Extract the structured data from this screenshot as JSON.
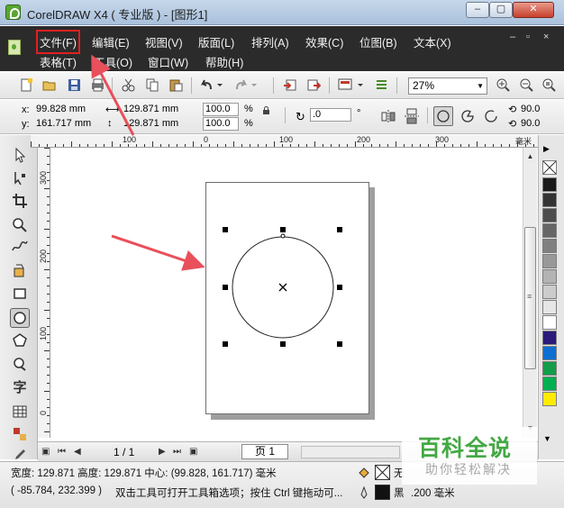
{
  "window": {
    "title": "CorelDRAW X4 ( 专业版 ) - [图形1]",
    "min_label": "–",
    "max_label": "▢",
    "close_label": "✕"
  },
  "menu": {
    "row1": [
      "文件(F)",
      "编辑(E)",
      "视图(V)",
      "版面(L)",
      "排列(A)",
      "效果(C)",
      "位图(B)",
      "文本(X)"
    ],
    "row2": [
      "表格(T)",
      "工具(O)",
      "窗口(W)",
      "帮助(H)"
    ],
    "mdi_buttons": [
      "–",
      "▫",
      "×"
    ]
  },
  "standard_toolbar": {
    "zoom_value": "27%",
    "icons": [
      "new-icon",
      "open-icon",
      "save-icon",
      "print-icon",
      "cut-icon",
      "copy-icon",
      "paste-icon",
      "undo-icon",
      "redo-icon",
      "import-icon",
      "export-icon",
      "application-launcher-icon",
      "welcome-screen-icon",
      "zoom-in-icon",
      "zoom-out-icon",
      "zoom-page-icon"
    ]
  },
  "property_bar": {
    "x_label": "x:",
    "y_label": "y:",
    "x_value": "99.828 mm",
    "y_value": "161.717 mm",
    "width_value": "129.871 mm",
    "height_value": "129.871 mm",
    "scale_x": "100.0",
    "scale_y": "100.0",
    "percent": "%",
    "rotation": ".0",
    "degree_symbol": "°",
    "angle1": "90.0",
    "angle2": "90.0"
  },
  "rulers": {
    "h_labels": [
      "100",
      "0",
      "100",
      "200",
      "300"
    ],
    "h_unit": "毫米",
    "v_labels": [
      "300",
      "200",
      "100",
      "0"
    ]
  },
  "page_nav": {
    "count": "1 / 1",
    "tab": "页 1"
  },
  "status": {
    "line1": "宽度: 129.871 高度: 129.871 中心: (99.828, 161.717) 毫米",
    "line2_coords": "( -85.784, 232.399 )",
    "line2_hint": "双击工具可打开工具箱选项；按住 Ctrl 键拖动可...",
    "fill_label": "无",
    "outline_color": "黑",
    "outline_width": ".200 毫米"
  },
  "watermark": {
    "main": "百科全说",
    "sub": "助你轻松解决"
  },
  "colors": {
    "highlight": "#e02020",
    "arrow": "#e8505b",
    "menubar": "#2b2b2b",
    "palette": [
      "#1a1a1a",
      "#333333",
      "#4d4d4d",
      "#666666",
      "#808080",
      "#999999",
      "#b3b3b3",
      "#cccccc",
      "#e6e6e6",
      "#ffffff",
      "#2b1a7a",
      "#0d6fd1",
      "#139d4a",
      "#00b050",
      "#ffeb00"
    ]
  }
}
